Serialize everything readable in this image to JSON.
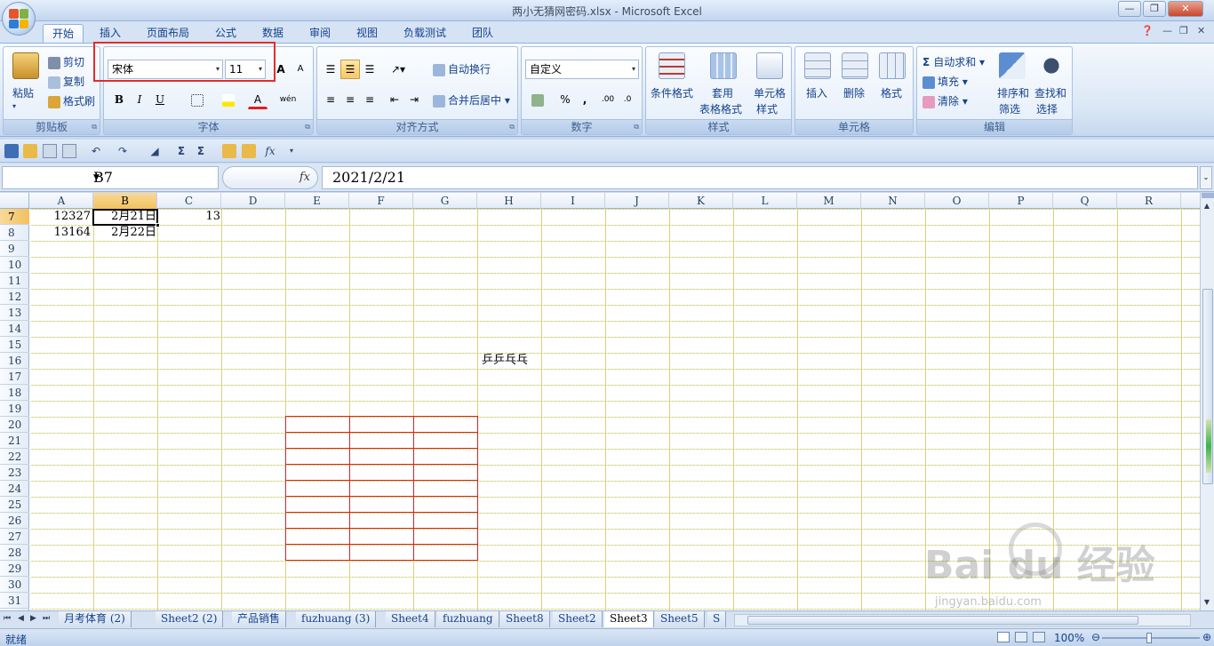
{
  "window": {
    "title": "两小无猜网密码.xlsx - Microsoft Excel",
    "controls": [
      "—",
      "❐",
      "✕"
    ]
  },
  "tabs": [
    "开始",
    "插入",
    "页面布局",
    "公式",
    "数据",
    "审阅",
    "视图",
    "负载测试",
    "团队"
  ],
  "ribbon": {
    "clipboard": {
      "label": "剪贴板",
      "paste": "粘贴",
      "cut": "剪切",
      "copy": "复制",
      "format_painter": "格式刷"
    },
    "font": {
      "label": "字体",
      "font_name": "宋体",
      "font_size": "11",
      "bold": "B",
      "italic": "I",
      "underline": "U",
      "grow": "A",
      "shrink": "A",
      "font_color": "A",
      "phonetic": "wén"
    },
    "alignment": {
      "label": "对齐方式",
      "wrap": "自动换行",
      "merge": "合并后居中"
    },
    "number": {
      "label": "数字",
      "format": "自定义",
      "percent": "%",
      "comma": ",",
      "inc": ".00",
      "dec": ".0"
    },
    "styles": {
      "label": "样式",
      "conditional": "条件格式",
      "table_format_1": "套用",
      "table_format_2": "表格格式",
      "cell_styles_1": "单元格",
      "cell_styles_2": "样式"
    },
    "cells": {
      "label": "单元格",
      "insert": "插入",
      "delete": "删除",
      "format": "格式"
    },
    "editing": {
      "label": "编辑",
      "autosum": "自动求和",
      "fill": "填充",
      "clear": "清除",
      "sort_1": "排序和",
      "sort_2": "筛选",
      "find_1": "查找和",
      "find_2": "选择"
    }
  },
  "qat": {
    "sigma1": "Σ",
    "sigma2": "Σ",
    "fx": "fx"
  },
  "formula_bar": {
    "name_box": "B7",
    "fx": "fx",
    "value": "2021/2/21"
  },
  "columns": [
    "A",
    "B",
    "C",
    "D",
    "E",
    "F",
    "G",
    "H",
    "I",
    "J",
    "K",
    "L",
    "M",
    "N",
    "O",
    "P",
    "Q",
    "R"
  ],
  "rows": [
    "7",
    "8",
    "9",
    "10",
    "11",
    "12",
    "13",
    "14",
    "15",
    "16",
    "17",
    "18",
    "19",
    "20",
    "21",
    "22",
    "23",
    "24",
    "25",
    "26",
    "27",
    "28",
    "29",
    "30",
    "31"
  ],
  "cells": {
    "A7": "12327",
    "B7": "2月21日",
    "C7": "13",
    "A8": "13164",
    "B8": "2月22日",
    "H16": "乒乒乓乓"
  },
  "sheet_tabs": [
    "月考体育 (2)",
    "Sheet2 (2)",
    "产品销售",
    "fuzhuang (3)",
    "Sheet4",
    "fuzhuang",
    "Sheet8",
    "Sheet2",
    "Sheet3",
    "Sheet5",
    "S"
  ],
  "active_sheet": "Sheet3",
  "status": {
    "text": "就绪",
    "zoom": "100%"
  },
  "watermark": {
    "brand": "Bai  du 经验",
    "url": "jingyan.baidu.com"
  },
  "colors": {
    "accent_red": "#e52c2c",
    "selection": "#f1c15f"
  }
}
